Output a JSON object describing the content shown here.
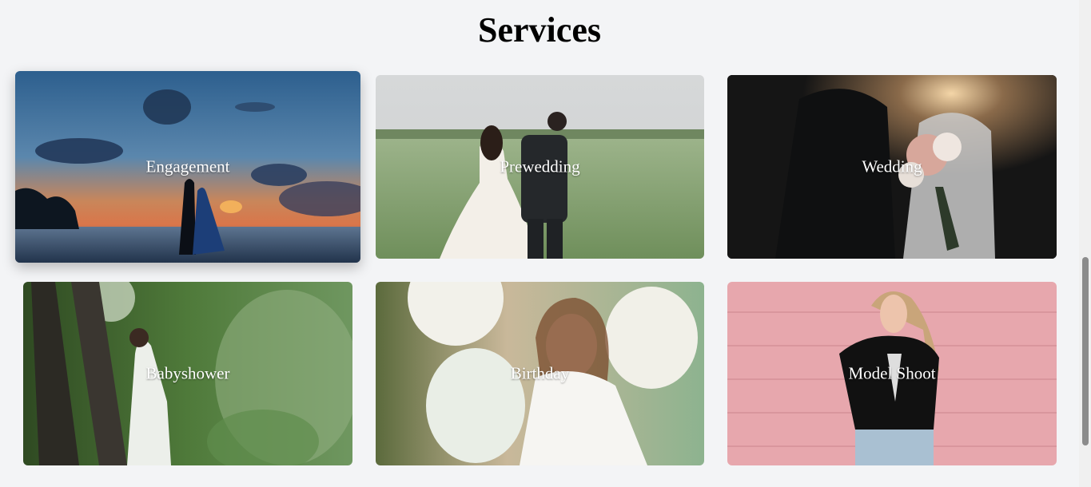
{
  "page": {
    "title": "Services"
  },
  "services": [
    {
      "label": "Engagement",
      "icon": "engagement-photo"
    },
    {
      "label": "Prewedding",
      "icon": "prewedding-photo"
    },
    {
      "label": "Wedding",
      "icon": "wedding-photo"
    },
    {
      "label": "Babyshower",
      "icon": "babyshower-photo"
    },
    {
      "label": "Birthday",
      "icon": "birthday-photo"
    },
    {
      "label": "Model Shoot",
      "icon": "model-shoot-photo"
    }
  ],
  "colors": {
    "background": "#f3f4f6",
    "label_text": "#ffffff",
    "title_text": "#000000"
  }
}
